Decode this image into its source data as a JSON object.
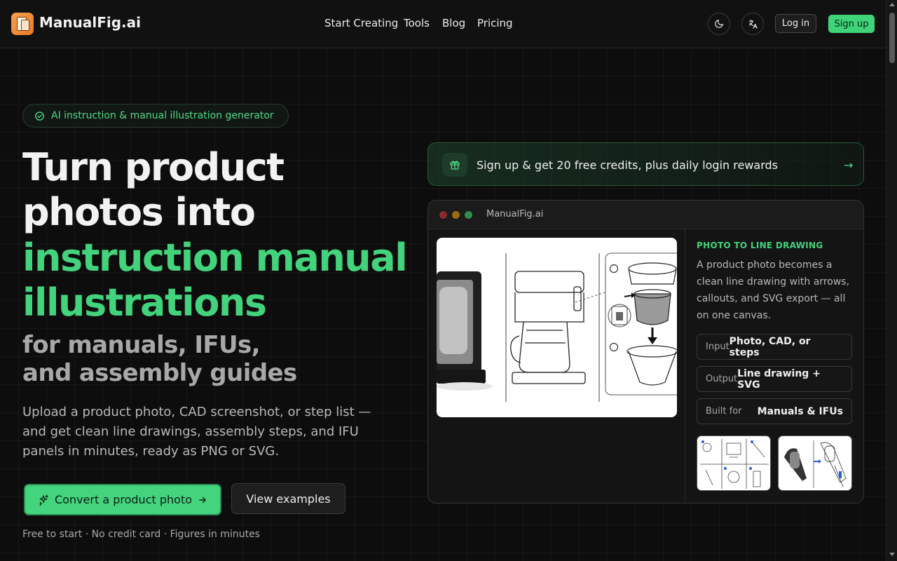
{
  "header": {
    "brand": "ManualFig.ai",
    "nav": [
      "Start Creating",
      "Tools",
      "Blog",
      "Pricing"
    ],
    "login_label": "Log in",
    "signup_label": "Sign up"
  },
  "hero": {
    "badge": "AI instruction & manual illustration generator",
    "title_line1": "Turn product",
    "title_line2": "photos into",
    "title_accent_line1": "instruction manual",
    "title_accent_line2": "illustrations",
    "subtitle_line1": "for manuals, IFUs,",
    "subtitle_line2": "and assembly guides",
    "description": "Upload a product photo, CAD screenshot, or step list — and get clean line drawings, assembly steps, and IFU panels in minutes, ready as PNG or SVG.",
    "cta_primary": "Convert a product photo",
    "cta_secondary": "View examples",
    "footnote": "Free to start · No credit card · Figures in minutes"
  },
  "promo": {
    "text": "Sign up & get 20 free credits, plus daily login rewards",
    "arrow": "→"
  },
  "demo": {
    "window_title": "ManualFig.ai",
    "eyebrow": "PHOTO TO LINE DRAWING",
    "description": "A product photo becomes a clean line drawing with arrows, callouts, and SVG export — all on one canvas.",
    "rows": [
      {
        "key": "Input",
        "value": "Photo, CAD, or steps"
      },
      {
        "key": "Output",
        "value": "Line drawing + SVG"
      },
      {
        "key": "Built for",
        "value": "Manuals & IFUs"
      }
    ]
  },
  "colors": {
    "accent": "#43d37c",
    "background": "#0d0d0d",
    "window_dot_red": "#d9534f",
    "window_dot_yellow": "#e0a526",
    "window_dot_green": "#3fbf62"
  },
  "icons": [
    "logo-icon",
    "moon-icon",
    "translate-icon",
    "check-circle-icon",
    "sparkle-icon",
    "arrow-right-icon",
    "gift-icon"
  ]
}
